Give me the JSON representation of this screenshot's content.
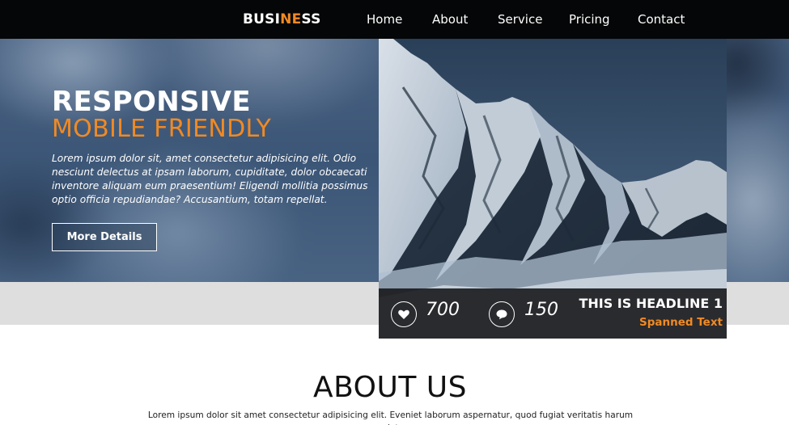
{
  "navbar": {
    "brand_prefix": "BUSI",
    "brand_accent": "NE",
    "brand_suffix": "SS",
    "items": [
      "Home",
      "About",
      "Service",
      "Pricing",
      "Contact"
    ]
  },
  "hero": {
    "title_line1": "RESPONSIVE",
    "title_line2": "MOBILE FRIENDLY",
    "body": "Lorem ipsum dolor sit, amet consectetur adipisicing elit. Odio nesciunt delectus at ipsam laborum, cupiditate, dolor obcaecati inventore aliquam eum praesentium! Eligendi mollitia possimus optio officia repudiandae? Accusantium, totam repellat.",
    "button_label": "More Details"
  },
  "card": {
    "image": "snowy-mountain-photo",
    "likes": "700",
    "comments": "150",
    "headline": "THIS IS HEADLINE 1",
    "subtext": "Spanned Text",
    "icons": {
      "likes": "heart-icon",
      "comments": "comment-icon"
    }
  },
  "about": {
    "title": "ABOUT US",
    "body": "Lorem ipsum dolor sit amet consectetur adipisicing elit. Eveniet laborum aspernatur, quod fugiat veritatis harum pariatur"
  },
  "colors": {
    "accent": "#f08a24",
    "nav_bg": "#050607",
    "band_gray": "#dedede"
  }
}
